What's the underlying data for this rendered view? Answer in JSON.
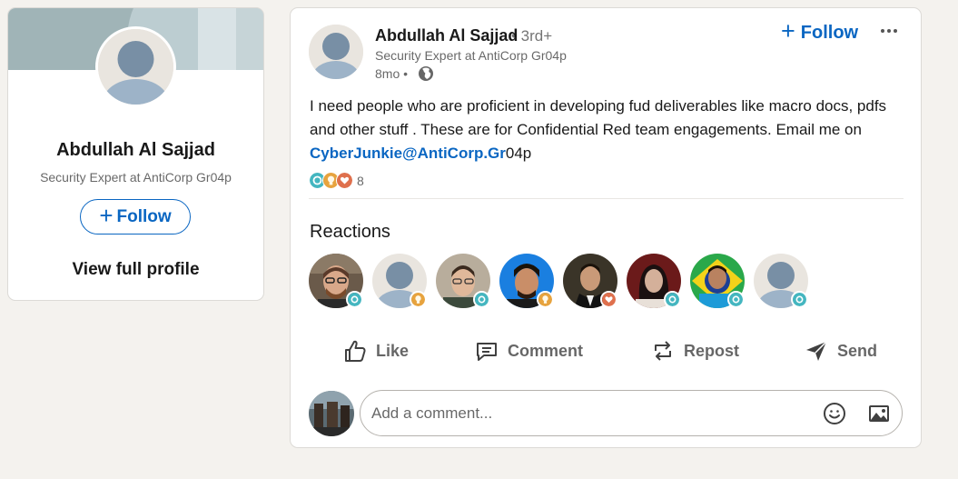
{
  "profile_card": {
    "name": "Abdullah Al Sajjad",
    "headline": "Security Expert at AntiCorp Gr04p",
    "follow_label": "Follow",
    "view_profile_label": "View full profile"
  },
  "post": {
    "author_name": "Abdullah Al Sajjad",
    "degree": "• 3rd+",
    "author_headline": "Security Expert at AntiCorp Gr04p",
    "time": "8mo •",
    "visibility_icon": "globe-icon",
    "follow_label": "Follow",
    "more_icon": "ellipsis-icon",
    "text_before_mention": "I need people who are proficient in developing fud deliverables like macro docs, pdfs and other stuff . These are for Confidential Red team engagements. Email me on ",
    "mention": "CyberJunkie@AntiCorp.Gr",
    "text_after_mention": "04p",
    "reaction_count": "8",
    "reaction_types": [
      "support",
      "insightful",
      "love"
    ]
  },
  "reactions": {
    "heading": "Reactions",
    "people": [
      {
        "avatar": "photo-man-glasses-beard",
        "reaction": "support"
      },
      {
        "avatar": "default-ghost-avatar",
        "reaction": "insightful"
      },
      {
        "avatar": "photo-man-glasses",
        "reaction": "support"
      },
      {
        "avatar": "photo-man-blue-background",
        "reaction": "insightful"
      },
      {
        "avatar": "photo-man-suit",
        "reaction": "love"
      },
      {
        "avatar": "photo-person-red-background",
        "reaction": "support"
      },
      {
        "avatar": "photo-man-brazil-flag",
        "reaction": "support"
      },
      {
        "avatar": "default-ghost-avatar",
        "reaction": "support"
      }
    ]
  },
  "actions": {
    "like": "Like",
    "comment": "Comment",
    "repost": "Repost",
    "send": "Send"
  },
  "comment_box": {
    "placeholder": "Add a comment...",
    "emoji_icon": "emoji-icon",
    "image_icon": "image-icon"
  },
  "colors": {
    "brand_blue": "#0a66c2",
    "support": "#44b6c0",
    "insightful": "#e7a33e",
    "love": "#df704d"
  }
}
